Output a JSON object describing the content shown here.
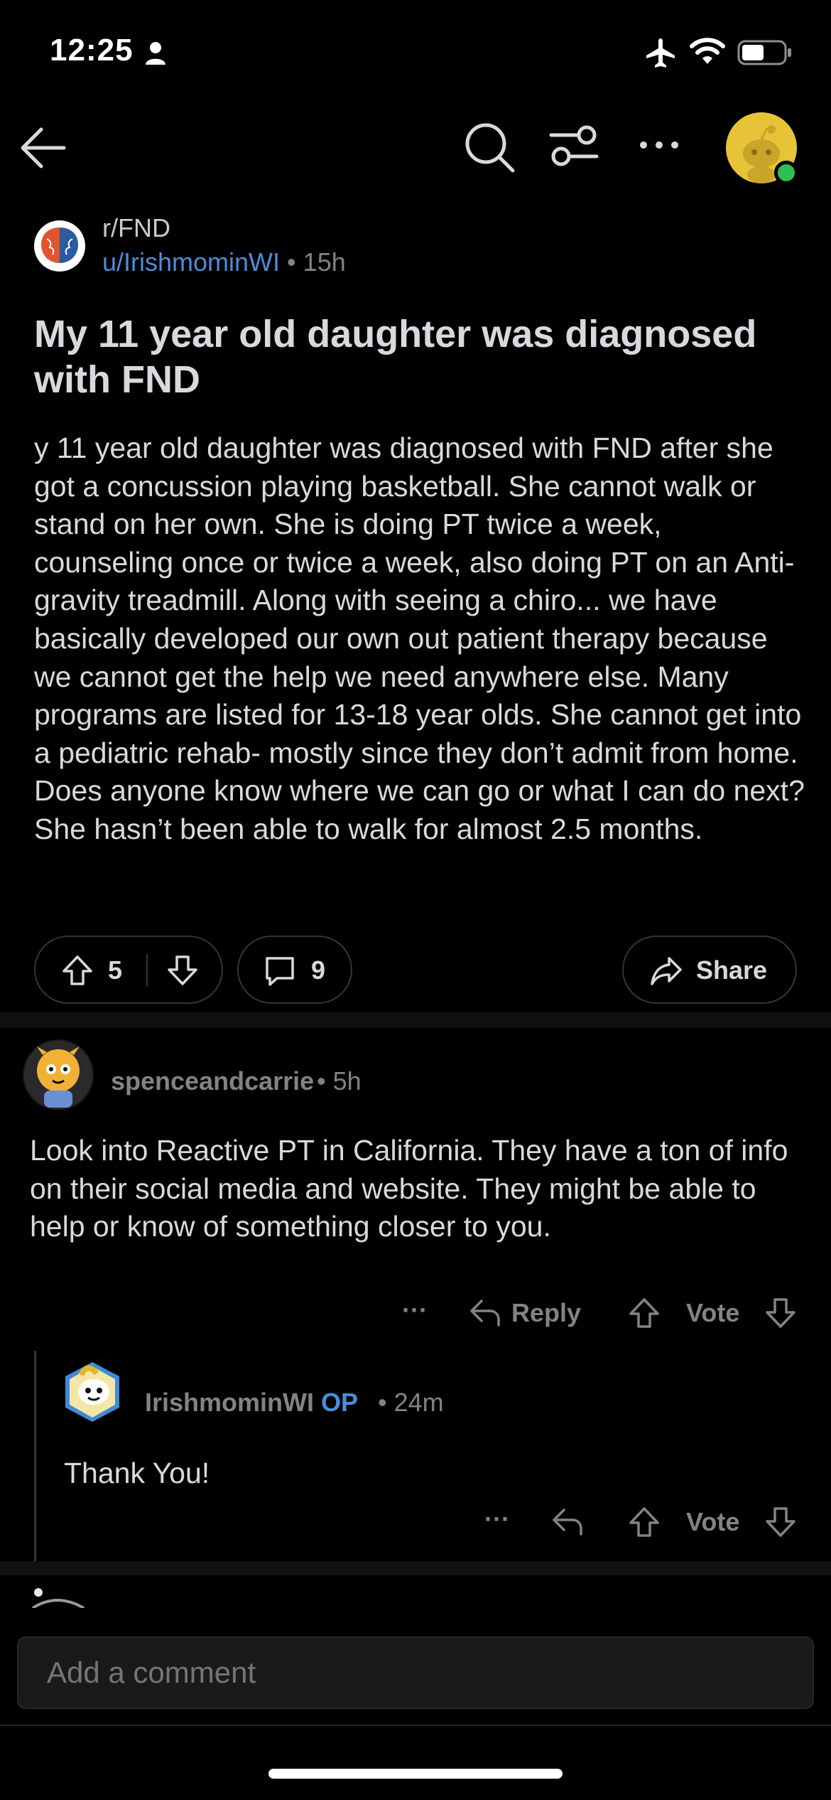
{
  "status_bar": {
    "time": "12:25"
  },
  "nav": {
    "back": "back",
    "icons": [
      "search-icon",
      "filter-icon",
      "more-icon"
    ],
    "avatar_color": "#e7c437",
    "online_color": "#2fbf55"
  },
  "post": {
    "subreddit": "r/FND",
    "author": "u/IrishmominWI",
    "separator": "•",
    "time": "15h",
    "title": "My 11 year old daughter was diagnosed with FND",
    "body": "y 11 year old daughter was diagnosed with FND after she got a concussion playing basketball. She cannot walk or stand on her own. She is doing PT twice a week,  counseling once or twice a week, also doing PT on an Anti- gravity treadmill. Along with seeing a chiro... we have basically developed our own out patient therapy because we cannot get the help we need anywhere else. Many programs are listed for 13-18 year olds. She cannot get into a pediatric rehab- mostly since they don’t admit from home. Does anyone know where we can go or what I can do next? She hasn’t been able to walk for almost 2.5 months.",
    "votes": "5",
    "comments": "9",
    "share_label": "Share"
  },
  "comments": [
    {
      "user": "spenceandcarrie",
      "separator": "•",
      "time": "5h",
      "text": "Look into Reactive PT in California.  They have a ton of info on their social media and website.  They might be able to help or know of something closer to you.",
      "more": "···",
      "reply_label": "Reply",
      "vote_label": "Vote"
    },
    {
      "user": "IrishmominWI",
      "op_badge": "OP",
      "separator": "•",
      "time": "24m",
      "text": "Thank You!",
      "more": "···",
      "vote_label": "Vote"
    }
  ],
  "composer": {
    "placeholder": "Add a comment"
  },
  "colors": {
    "accent": "#4b8ddb",
    "background": "#000000",
    "muted": "#818384"
  }
}
